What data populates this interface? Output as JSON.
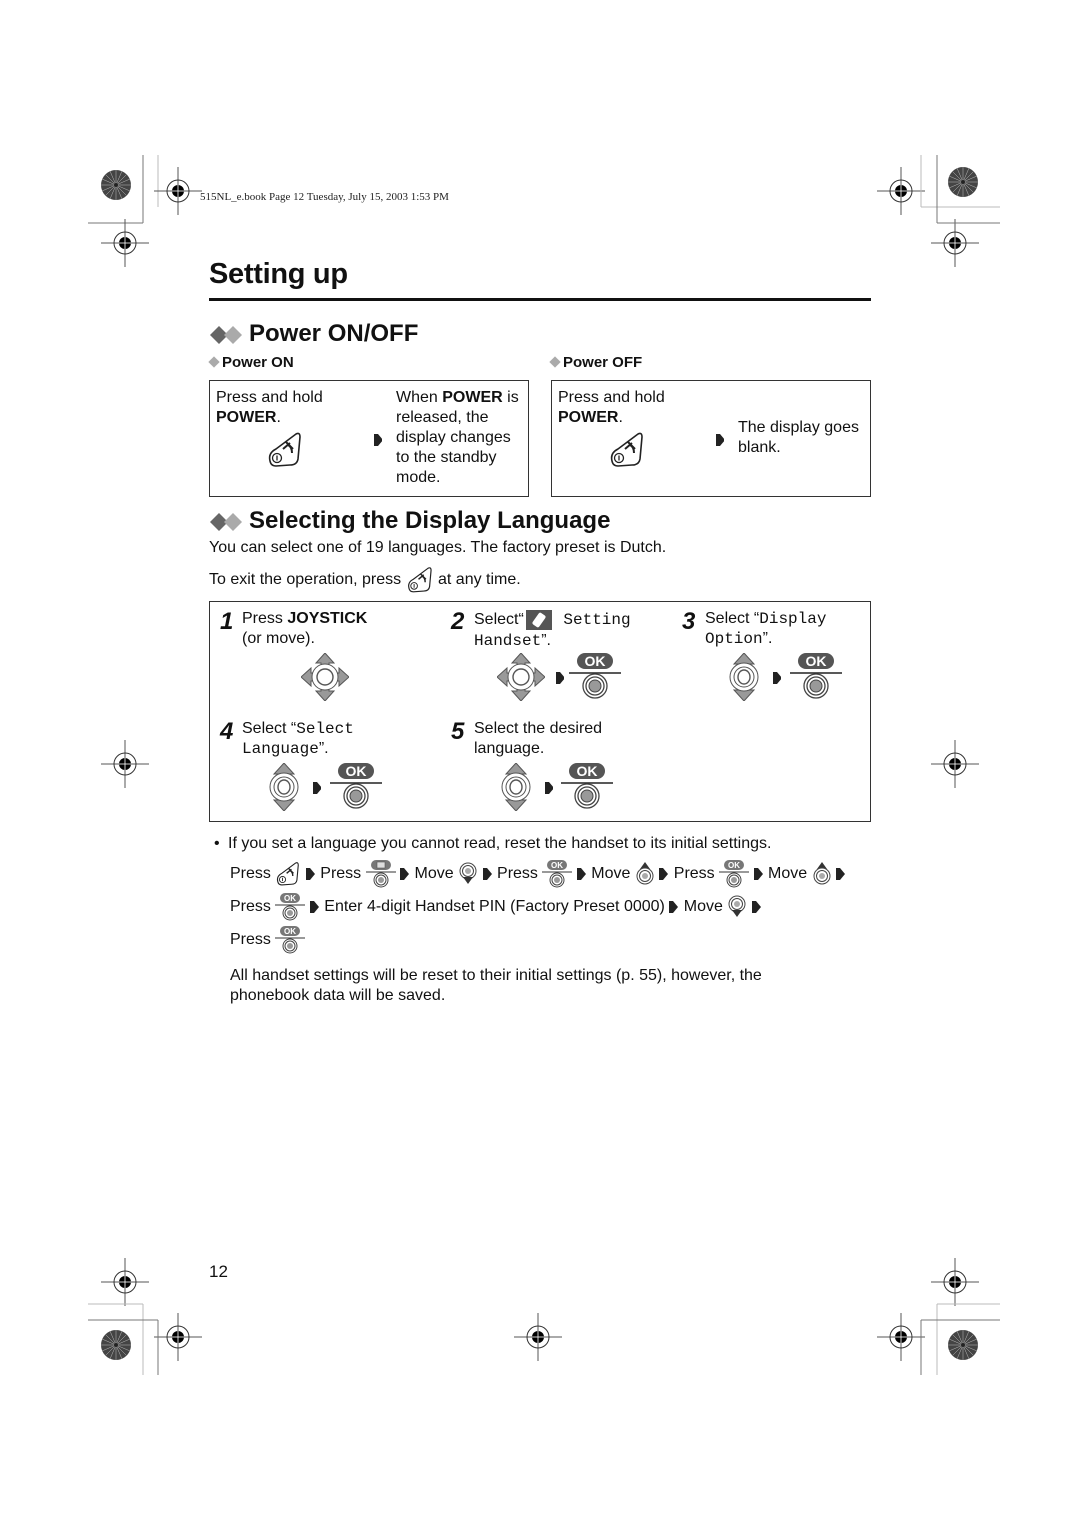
{
  "header": {
    "file_info": "515NL_e.book  Page 12  Tuesday, July 15, 2003  1:53 PM"
  },
  "page_title": "Setting up",
  "power_section": {
    "title": "Power ON/OFF",
    "power_on": {
      "heading": "Power ON",
      "instruction_line1": "Press and hold",
      "instruction_key": "POWER",
      "instruction_end": ".",
      "result_prefix": "When ",
      "result_key": "POWER",
      "result_suffix": " is",
      "result_line2": "released, the",
      "result_line3": "display changes",
      "result_line4": "to the standby",
      "result_line5": "mode."
    },
    "power_off": {
      "heading": "Power OFF",
      "instruction_line1": "Press and hold",
      "instruction_key": "POWER",
      "instruction_end": ".",
      "result_line1": "The display goes",
      "result_line2": "blank."
    }
  },
  "language_section": {
    "title": "Selecting the Display Language",
    "intro": "You can select one of 19 languages. The factory preset is Dutch.",
    "exit_prefix": "To exit the operation, press",
    "exit_suffix": "at any time.",
    "steps": [
      {
        "num": "1",
        "text_a": "Press ",
        "key": "JOYSTICK",
        "text_b": "(or move)."
      },
      {
        "num": "2",
        "text_a": "Select“",
        "mono_a": " Setting",
        "mono_b": "Handset",
        "text_b": "”."
      },
      {
        "num": "3",
        "text_a": "Select “",
        "mono_a": "Display",
        "mono_b": "Option",
        "text_b": "”."
      },
      {
        "num": "4",
        "text_a": "Select “",
        "mono_a": "Select",
        "mono_b": "Language",
        "text_b": "”."
      },
      {
        "num": "5",
        "text_a": "Select the desired",
        "text_b": "language."
      }
    ],
    "ok_label": "OK"
  },
  "note": {
    "bullet": "•",
    "text": "If you set a language you cannot read, reset the handset to its initial settings.",
    "seq_line1": [
      "Press",
      "Press",
      "Move",
      "Press",
      "Move",
      "Press",
      "Move"
    ],
    "seq_line2_press": "Press",
    "seq_line2_enter": "Enter 4-digit Handset PIN (Factory Preset 0000)",
    "seq_line2_move": "Move",
    "seq_line3_press": "Press",
    "footer_line1": "All handset settings will be reset to their initial settings (p. 55), however, the",
    "footer_line2": "phonebook data will be saved."
  },
  "page_number": "12"
}
